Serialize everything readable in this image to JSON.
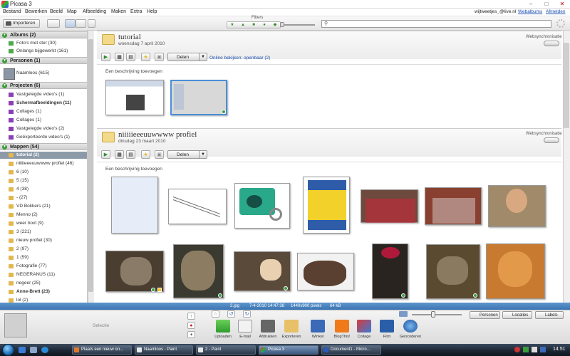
{
  "window": {
    "title": "Picasa 3",
    "controls": [
      "–",
      "□",
      "✕"
    ]
  },
  "menubar": [
    "Bestand",
    "Bewerken",
    "Beeld",
    "Map",
    "Afbeelding",
    "Maken",
    "Extra",
    "Help"
  ],
  "account": {
    "email": "wijtweetjes_@live.nl",
    "webalbums": "Webalbums",
    "logout": "Afmelden"
  },
  "toolbar": {
    "import_label": "Importeren",
    "filters_label": "Filters",
    "search_placeholder": ""
  },
  "sidebar": {
    "albums": {
      "title": "Albums (2)",
      "items": [
        "Foto's met ster (30)",
        "Onlangs bijgewerkt (161)"
      ]
    },
    "people": {
      "title": "Personen (1)",
      "items": [
        "Naamloos (615)"
      ]
    },
    "projects": {
      "title": "Projecten (6)",
      "items": [
        "Vastgelegde video's (1)",
        "Schermafbeeldingen (11)",
        "Collages (1)",
        "Collages (1)",
        "Vastgelegde video's (2)",
        "Geëxporteerde video's (1)"
      ]
    },
    "folders": {
      "title": "Mappen (54)",
      "items": [
        "tutorial (2)",
        "niiiiieeeuuwwww profiel (46)",
        "6 (10)",
        "5 (15)",
        "4 (38)",
        "- (27)",
        "VD Bokkers (21)",
        "Menno (2)",
        "weer boxt (9)",
        "3 (221)",
        "nieuw profiel (30)",
        "2 (97)",
        "1 (59)",
        "Fotografie (77)",
        "NEGERANUS (11)",
        "negeer (25)",
        "Anne-Brett (23)",
        "lol (2)"
      ]
    }
  },
  "albums": [
    {
      "title": "tutorial",
      "date": "woensdag 7 april 2010",
      "websync": "Websynchronisatie",
      "share": "Delen",
      "online": "Online bekijken: openbaar (2)",
      "description": "Een beschrijving toevoegen"
    },
    {
      "title": "niiiiieeeuuwwww profiel",
      "date": "dinsdag 23 maart 2010",
      "websync": "Websynchronisatie",
      "share": "Delen",
      "description": "Een beschrijving toevoegen"
    }
  ],
  "status": {
    "file": "2.jpg",
    "date": "7-4-2010 14:47:38",
    "dims": "1440x900 pixels",
    "size": "64 kB"
  },
  "tray": {
    "selection_label": "Selectie",
    "people_btn": "Personen",
    "places_btn": "Locaties",
    "labels_btn": "Labels",
    "actions": [
      "Uploaden",
      "E-mail",
      "Afdrukken",
      "Exporteren",
      "Winkel",
      "BlogThis!",
      "Collage",
      "Film",
      "Geocoderen"
    ]
  },
  "taskbar": {
    "tasks": [
      "Plaats een nieuw on...",
      "Naamloos - Paint",
      "2 - Paint",
      "Picasa 3",
      "Document1 - Micro..."
    ],
    "clock": "14:51"
  },
  "icons": {
    "logo": "picasa-logo-icon",
    "search": "search-icon",
    "folder": "folder-icon",
    "play": "play-icon",
    "star": "star-icon",
    "start": "windows-start-icon"
  },
  "colors": {
    "statusbar": "#3b74b3",
    "selection": "#8c9aa8",
    "accent": "#3a9c3a",
    "link": "#1a4fb0"
  }
}
